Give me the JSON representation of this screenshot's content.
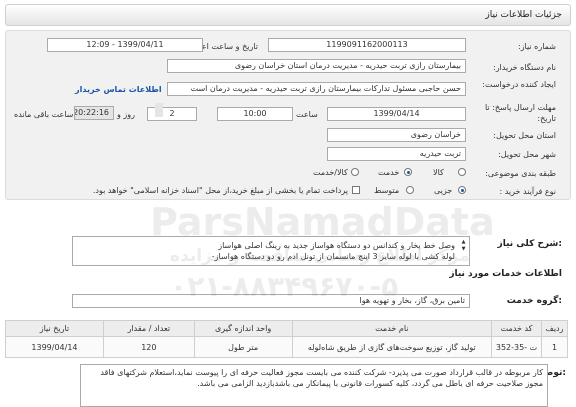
{
  "header": {
    "title": "جزئیات اطلاعات نیاز"
  },
  "form": {
    "need_number_label": "شماره نیاز:",
    "need_number": "1199091162000113",
    "announce_label": "تاریخ و ساعت اعلان عمومی:",
    "announce_value": "1399/04/11 - 12:09",
    "buyer_label": "نام دستگاه خریدار:",
    "buyer": "بیمارستان رازی تربت حیدریه - مدیریت درمان استان خراسان رضوی",
    "creator_label": "ایجاد کننده درخواست:",
    "creator": "حسن حاجبی مسئول تدارکات بیمارستان رازی تربت حیدریه - مدیریت درمان است",
    "contact_link": "اطلاعات تماس خریدار",
    "deadline_label": "مهلت ارسال پاسخ: تا تاریخ:",
    "deadline_date": "1399/04/14",
    "time_label": "ساعت",
    "deadline_time": "10:00",
    "days_value": "2",
    "days_label": "روز و",
    "remaining_time": "20:22:16",
    "remaining_label": "ساعت باقی مانده",
    "province_label": "استان محل تحویل:",
    "province": "خراسان رضوی",
    "city_label": "شهر محل تحویل:",
    "city": "تربت حیدریه",
    "category_label": "طبقه بندی موضوعی:",
    "category_options": [
      "کالا",
      "خدمت",
      "کالا/خدمت"
    ],
    "category_selected": "خدمت",
    "process_label": "نوع فرآیند خرید :",
    "process_options": [
      "جزیی",
      "متوسط"
    ],
    "process_selected": "جزیی",
    "payment_note": "پرداخت تمام یا بخشی از مبلغ خرید،از محل \"اسناد خزانه اسلامی\" خواهد بود."
  },
  "description": {
    "label": "شرح کلی نیاز:",
    "line1": "وصل خط بخار و کندانس دو دستگاه هواساز جدید به رینگ اصلی هواساز",
    "line2": "لوله کشی با لوله سایز 3 اینچ مانسمان  از تونل ادم رو دو دستگاه هواساز-"
  },
  "services": {
    "title": "اطلاعات خدمات مورد نیاز",
    "group_label": "گروه خدمت:",
    "group_value": "تامین برق، گاز، بخار و تهویه هوا",
    "table": {
      "headers": [
        "ردیف",
        "کد خدمت",
        "نام خدمت",
        "واحد اندازه گیری",
        "تعداد / مقدار",
        "تاریخ نیاز"
      ],
      "rows": [
        [
          "1",
          "ت -35-352",
          "تولید گاز، توزیع سوخت‌های گازی از طریق شاه‌لوله",
          "متر طول",
          "120",
          "1399/04/14"
        ]
      ]
    }
  },
  "notes": {
    "label": "توضیحات خریدار:",
    "text": "کار مربوطه در قالب قرارداد صورت می پذیرد- شرکت کننده می بایست مجوز فعالیت حرفه ای را پیوست نماید،استعلام شرکتهای فاقد مجوز صلاحیت حرفه ای باطل می گردد، کلیه کسورات قانونی با پیمانکار می باشدبازدید الزامی می باشد."
  },
  "watermark": {
    "brand": "ParsNamadData",
    "tagline": "مرکز اطلاع رسانی مناقصه و مزایده",
    "phone": "۰۲۱-۸۸۳۴۹۶۷۰-۵"
  },
  "colors": {
    "link": "#1a55a8",
    "panel": "#f1f1f1",
    "border": "#aaaaaa"
  }
}
